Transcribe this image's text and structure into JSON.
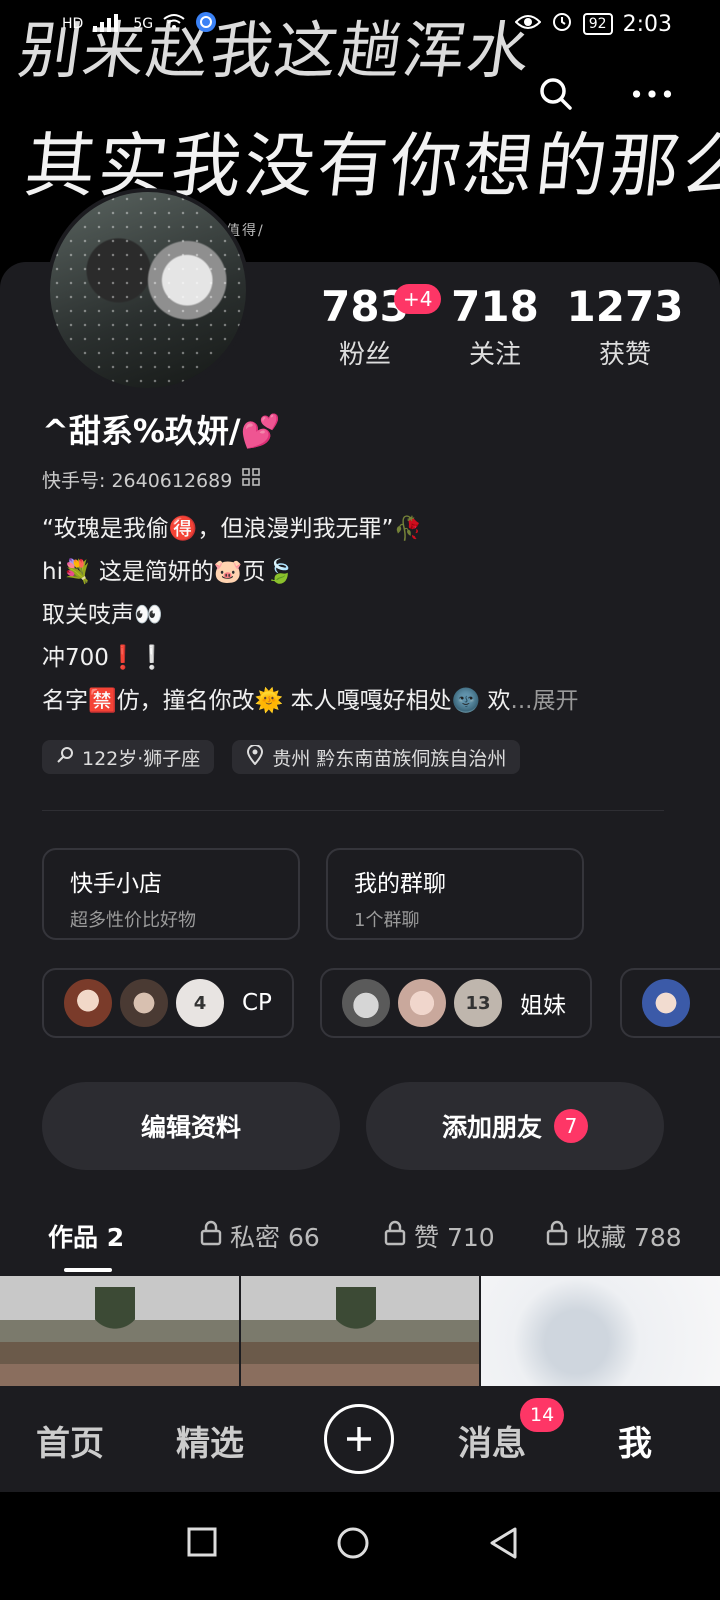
{
  "banner": {
    "line1": "别来赵我这趟浑水",
    "line2": "其实我没有你想的那么值得",
    "small": "么值得/"
  },
  "status_bar": {
    "left_icons": [
      "hd-icon",
      "signal-icon",
      "wifi-icon",
      "app-icon"
    ],
    "hd": "HD",
    "network": "5G",
    "battery": "92",
    "time": "2:03"
  },
  "profile": {
    "name": "^甜系%玖妍/💕",
    "kuaishou_id": "快手号: 2640612689",
    "bio": [
      "“玫瑰是我偷🉐，但浪漫判我无罪”🥀",
      "hi💐    这是简妍的🐷页🍃",
      "取关吱声👀",
      "冲700❗❕"
    ],
    "bio_last": "名字🈲仿，撞名你改🌞 本人嘎嘎好相处🌚 欢",
    "expand": "...展开",
    "tags": [
      "122岁·狮子座",
      "贵州 黔东南苗族侗族自治州"
    ]
  },
  "stats": [
    {
      "value": "783",
      "label": "粉丝",
      "badge": "+4"
    },
    {
      "value": "718",
      "label": "关注"
    },
    {
      "value": "1273",
      "label": "获赞"
    }
  ],
  "features": [
    {
      "title": "快手小店",
      "subtitle": "超多性价比好物"
    },
    {
      "title": "我的群聊",
      "subtitle": "1个群聊"
    }
  ],
  "relationships": [
    {
      "count": "4",
      "label": "CP"
    },
    {
      "count": "13",
      "label": "姐妹"
    }
  ],
  "buttons": {
    "edit": "编辑资料",
    "add_friend": "添加朋友",
    "add_friend_badge": "7"
  },
  "tabs": {
    "works": "作品 2",
    "private": "私密 66",
    "likes": "赞 710",
    "favorites": "收藏 788"
  },
  "nav": {
    "home": "首页",
    "featured": "精选",
    "messages": "消息",
    "messages_badge": "14",
    "me": "我"
  },
  "colors": {
    "accent": "#fe3666",
    "background": "#1c1c20",
    "card_border": "#35353b"
  }
}
